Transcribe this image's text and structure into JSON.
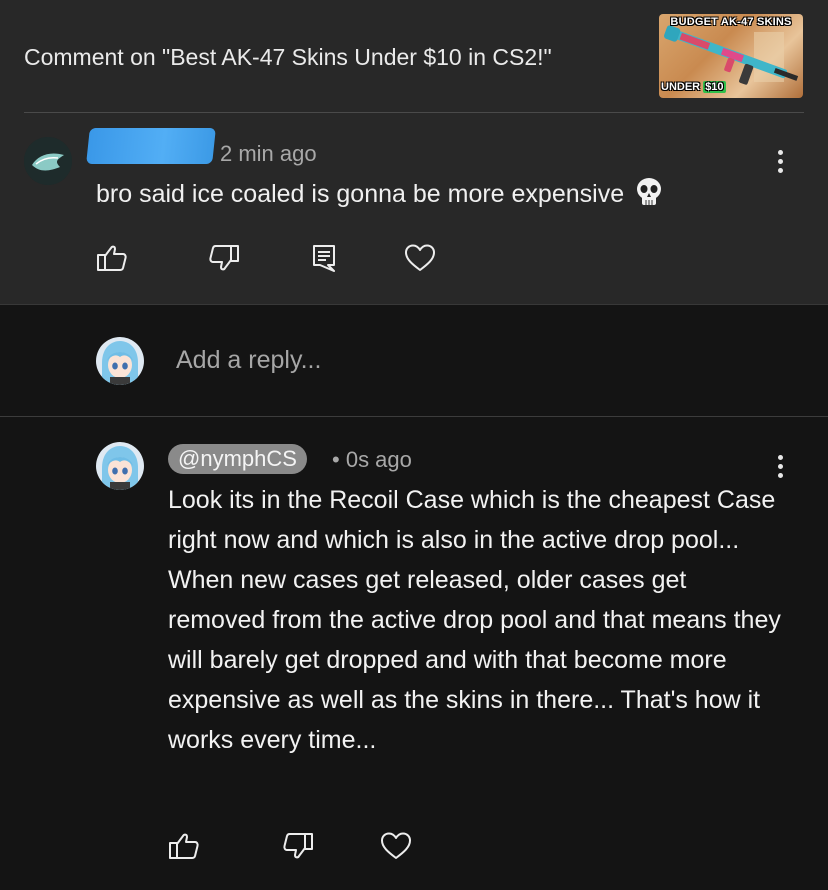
{
  "header": {
    "title": "Comment on \"Best AK-47 Skins Under $10 in CS2!\"",
    "thumbnail": {
      "top_text": "BUDGET AK-47 SKINS",
      "under_text": "UNDER",
      "price_text": "$10"
    }
  },
  "comment": {
    "author_redacted": true,
    "time": "2 min ago",
    "text": "bro said ice coaled is gonna be more expensive",
    "emoji": "skull-emoji",
    "actions": [
      "like-icon",
      "dislike-icon",
      "reply-icon",
      "heart-icon"
    ]
  },
  "reply_box": {
    "placeholder": "Add a reply..."
  },
  "reply": {
    "handle": "@nymphCS",
    "separator": "•",
    "time": "0s ago",
    "text": "Look its in the Recoil Case which is the cheapest Case right now and which is also in the active drop pool... When new cases get released, older cases get removed from the active drop pool and that means they will barely get dropped and with that become more expensive as well as the skins in there... That's how it works every time...",
    "actions": [
      "like-icon",
      "dislike-icon",
      "heart-icon"
    ]
  },
  "colors": {
    "top_card_bg": "#282828",
    "page_bg": "#141414",
    "redaction_blue": "#3a98e8",
    "handle_chip": "#8a8a8a"
  }
}
